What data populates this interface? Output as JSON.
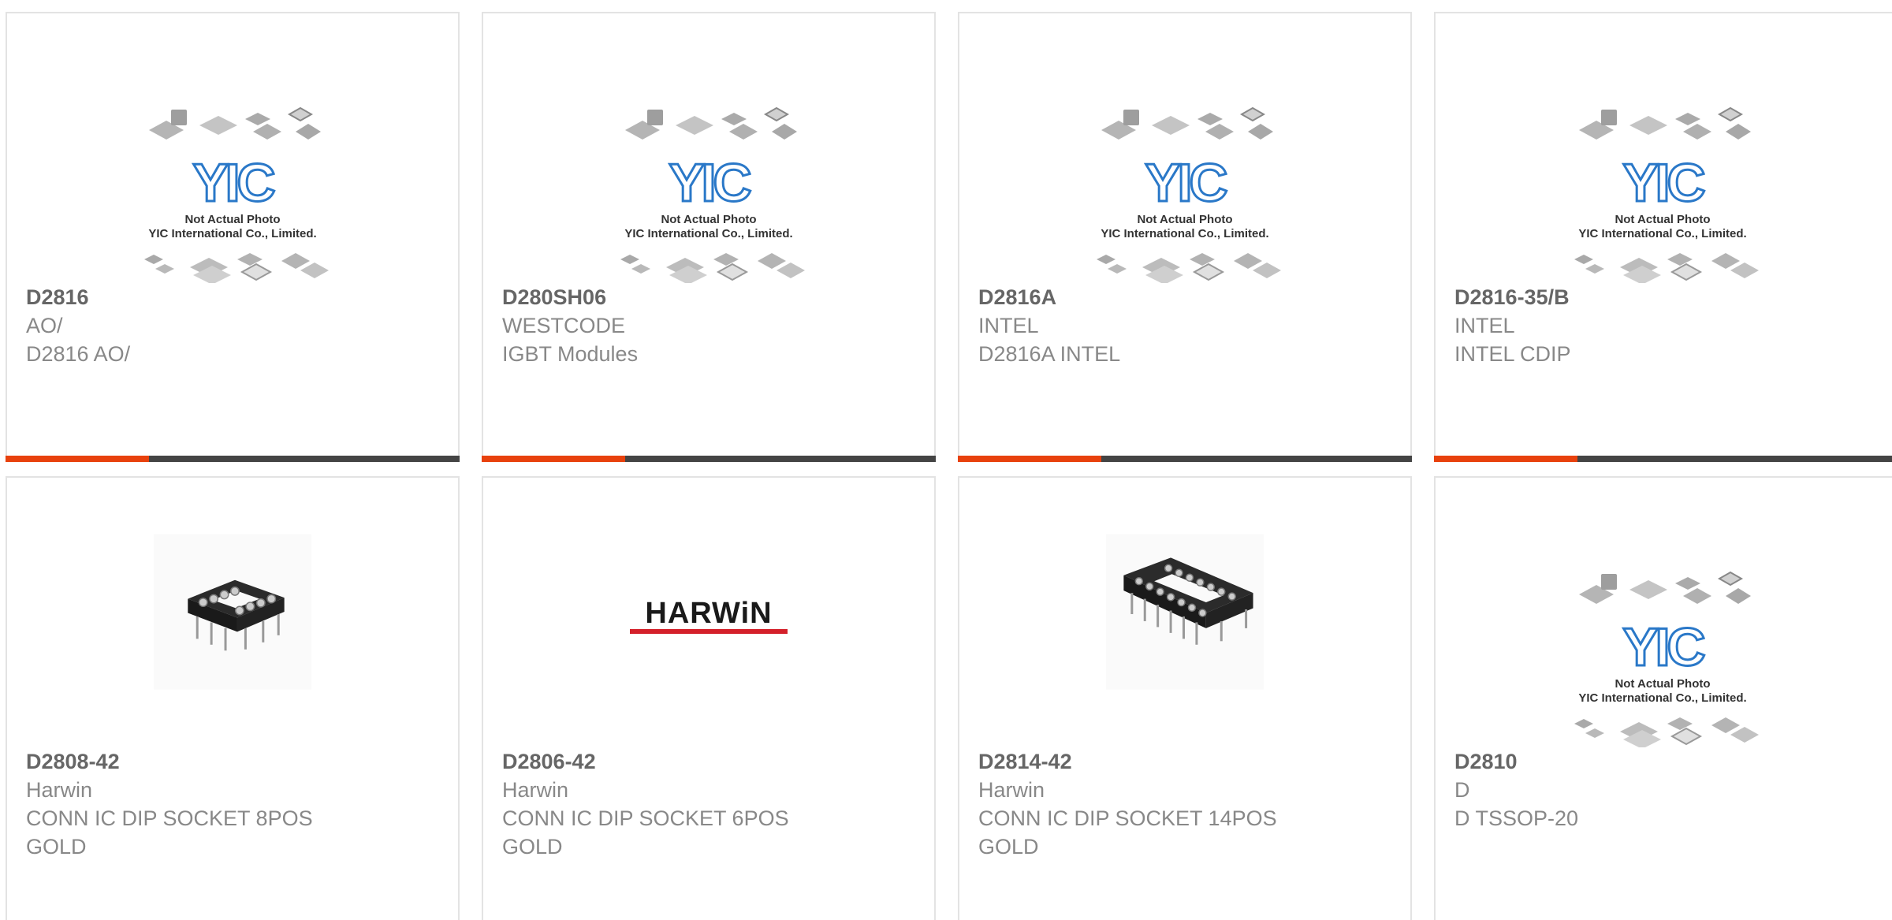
{
  "colors": {
    "accent": "#e8410d",
    "bar_dark": "#444444",
    "yic_blue": "#2a78c8",
    "harwin_red": "#d4202a"
  },
  "placeholder": {
    "line1": "Not Actual Photo",
    "line2": "YIC International Co., Limited.",
    "logo": "YIC"
  },
  "harwin_logo": "HARWiN",
  "products": [
    {
      "part": "D2816",
      "maker": "AO/",
      "desc": "D2816 AO/",
      "desc2": "",
      "image": "yic-placeholder"
    },
    {
      "part": "D280SH06",
      "maker": "WESTCODE",
      "desc": "IGBT Modules",
      "desc2": "",
      "image": "yic-placeholder"
    },
    {
      "part": "D2816A",
      "maker": "INTEL",
      "desc": "D2816A INTEL",
      "desc2": "",
      "image": "yic-placeholder"
    },
    {
      "part": "D2816-35/B",
      "maker": "INTEL",
      "desc": "INTEL CDIP",
      "desc2": "",
      "image": "yic-placeholder"
    },
    {
      "part": "D2808-42",
      "maker": "Harwin",
      "desc": "CONN IC DIP SOCKET 8POS",
      "desc2": "GOLD",
      "image": "dip-socket-8"
    },
    {
      "part": "D2806-42",
      "maker": "Harwin",
      "desc": "CONN IC DIP SOCKET 6POS",
      "desc2": "GOLD",
      "image": "harwin-logo"
    },
    {
      "part": "D2814-42",
      "maker": "Harwin",
      "desc": "CONN IC DIP SOCKET 14POS",
      "desc2": "GOLD",
      "image": "dip-socket-14"
    },
    {
      "part": "D2810",
      "maker": "D",
      "desc": "D TSSOP-20",
      "desc2": "",
      "image": "yic-placeholder"
    }
  ]
}
